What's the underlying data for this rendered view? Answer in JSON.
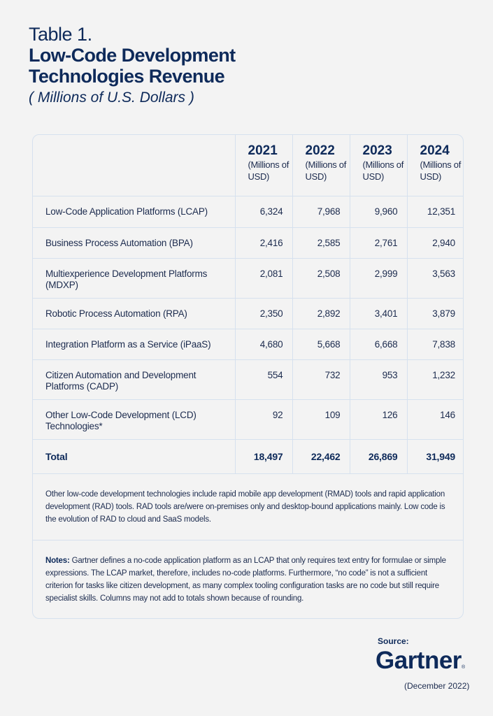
{
  "title": {
    "label": "Table 1.",
    "main_line1": "Low-Code Development",
    "main_line2": "Technologies Revenue",
    "subtitle": "( Millions of U.S. Dollars )"
  },
  "table": {
    "columns": [
      {
        "year": "2021",
        "unit": "(Millions of USD)"
      },
      {
        "year": "2022",
        "unit": "(Millions of USD)"
      },
      {
        "year": "2023",
        "unit": "(Millions of USD)"
      },
      {
        "year": "2024",
        "unit": "(Millions of USD)"
      }
    ],
    "rows": [
      {
        "label": "Low-Code Application Platforms (LCAP)",
        "values": [
          "6,324",
          "7,968",
          "9,960",
          "12,351"
        ]
      },
      {
        "label": "Business Process Automation (BPA)",
        "values": [
          "2,416",
          "2,585",
          "2,761",
          "2,940"
        ]
      },
      {
        "label": "Multiexperience Development Platforms (MDXP)",
        "values": [
          "2,081",
          "2,508",
          "2,999",
          "3,563"
        ]
      },
      {
        "label": "Robotic Process Automation (RPA)",
        "values": [
          "2,350",
          "2,892",
          "3,401",
          "3,879"
        ]
      },
      {
        "label": "Integration Platform as a Service (iPaaS)",
        "values": [
          "4,680",
          "5,668",
          "6,668",
          "7,838"
        ]
      },
      {
        "label": "Citizen Automation and Development Platforms (CADP)",
        "values": [
          "554",
          "732",
          "953",
          "1,232"
        ]
      },
      {
        "label": "Other Low-Code Development (LCD) Technologies*",
        "values": [
          "92",
          "109",
          "126",
          "146"
        ]
      }
    ],
    "total": {
      "label": "Total",
      "values": [
        "18,497",
        "22,462",
        "26,869",
        "31,949"
      ]
    }
  },
  "footnote": "Other low-code development technologies include rapid mobile app development (RMAD) tools and rapid application development (RAD) tools. RAD tools are/were on-premises only and desktop-bound applications mainly. Low code is the evolution of RAD to cloud and SaaS models.",
  "notes": {
    "label": "Notes:",
    "text": " Gartner defines a no-code application platform as an LCAP that only requires text entry for formulae or simple expressions. The LCAP market, therefore, includes no-code platforms. Furthermore, “no code” is not a sufficient criterion for tasks like citizen development, as many complex tooling configuration tasks are no code but still require specialist skills. Columns may not add to totals shown because of rounding."
  },
  "source": {
    "label": "Source:",
    "brand": "Gartner",
    "registered": "®",
    "date": "(December 2022)"
  },
  "colors": {
    "navy": "#0e2a5a",
    "text": "#1c2b4e",
    "border": "#d6e1ee",
    "background": "#f3f3f3"
  }
}
